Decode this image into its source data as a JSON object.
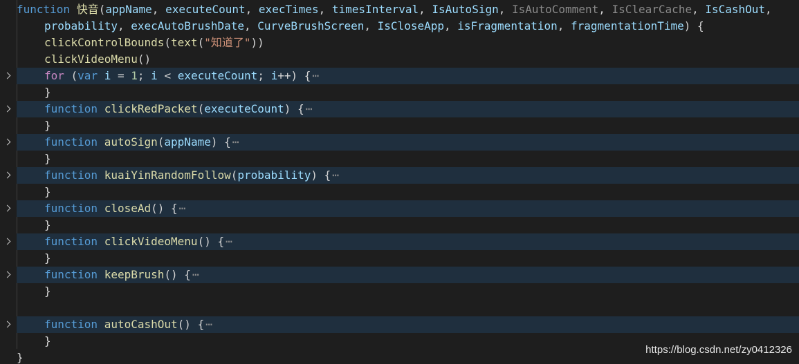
{
  "code_lines": [
    {
      "tokens": [
        [
          "kw",
          "function"
        ],
        [
          "pn",
          " "
        ],
        [
          "fn",
          "快音"
        ],
        [
          "pn",
          "("
        ],
        [
          "pm",
          "appName"
        ],
        [
          "pn",
          ", "
        ],
        [
          "pm",
          "executeCount"
        ],
        [
          "pn",
          ", "
        ],
        [
          "pm",
          "execTimes"
        ],
        [
          "pn",
          ", "
        ],
        [
          "pm",
          "timesInterval"
        ],
        [
          "pn",
          ", "
        ],
        [
          "pm",
          "IsAutoSign"
        ],
        [
          "pn",
          ", "
        ],
        [
          "dim",
          "IsAutoComment"
        ],
        [
          "pn",
          ", "
        ],
        [
          "dim",
          "IsClearCache"
        ],
        [
          "pn",
          ", "
        ],
        [
          "pm",
          "IsCashOut"
        ],
        [
          "pn",
          ","
        ]
      ]
    },
    {
      "tokens": [
        [
          "pm",
          "probability"
        ],
        [
          "pn",
          ", "
        ],
        [
          "pm",
          "execAutoBrushDate"
        ],
        [
          "pn",
          ", "
        ],
        [
          "pm",
          "CurveBrushScreen"
        ],
        [
          "pn",
          ", "
        ],
        [
          "pm",
          "IsCloseApp"
        ],
        [
          "pn",
          ", "
        ],
        [
          "pm",
          "isFragmentation"
        ],
        [
          "pn",
          ", "
        ],
        [
          "pm",
          "fragmentationTime"
        ],
        [
          "pn",
          ") {"
        ]
      ]
    },
    {
      "tokens": [
        [
          "fn",
          "clickControlBounds"
        ],
        [
          "pn",
          "("
        ],
        [
          "fn",
          "text"
        ],
        [
          "pn",
          "("
        ],
        [
          "st",
          "\"知道了\""
        ],
        [
          "pn",
          "))"
        ]
      ]
    },
    {
      "tokens": [
        [
          "fn",
          "clickVideoMenu"
        ],
        [
          "pn",
          "()"
        ]
      ]
    },
    {
      "folded": true,
      "tokens": [
        [
          "ctl",
          "for"
        ],
        [
          "pn",
          " ("
        ],
        [
          "kw",
          "var"
        ],
        [
          "pn",
          " "
        ],
        [
          "pm",
          "i"
        ],
        [
          "pn",
          " = "
        ],
        [
          "nm",
          "1"
        ],
        [
          "pn",
          "; "
        ],
        [
          "pm",
          "i"
        ],
        [
          "pn",
          " < "
        ],
        [
          "pm",
          "executeCount"
        ],
        [
          "pn",
          "; "
        ],
        [
          "pm",
          "i"
        ],
        [
          "pn",
          "++) {"
        ]
      ]
    },
    {
      "tokens": [
        [
          "pn",
          "}"
        ]
      ]
    },
    {
      "folded": true,
      "tokens": [
        [
          "kw",
          "function"
        ],
        [
          "pn",
          " "
        ],
        [
          "fn",
          "clickRedPacket"
        ],
        [
          "pn",
          "("
        ],
        [
          "pm",
          "executeCount"
        ],
        [
          "pn",
          ") {"
        ]
      ]
    },
    {
      "tokens": [
        [
          "pn",
          "}"
        ]
      ]
    },
    {
      "folded": true,
      "tokens": [
        [
          "kw",
          "function"
        ],
        [
          "pn",
          " "
        ],
        [
          "fn",
          "autoSign"
        ],
        [
          "pn",
          "("
        ],
        [
          "pm",
          "appName"
        ],
        [
          "pn",
          ") {"
        ]
      ]
    },
    {
      "tokens": [
        [
          "pn",
          "}"
        ]
      ]
    },
    {
      "folded": true,
      "tokens": [
        [
          "kw",
          "function"
        ],
        [
          "pn",
          " "
        ],
        [
          "fn",
          "kuaiYinRandomFollow"
        ],
        [
          "pn",
          "("
        ],
        [
          "pm",
          "probability"
        ],
        [
          "pn",
          ") {"
        ]
      ]
    },
    {
      "tokens": [
        [
          "pn",
          "}"
        ]
      ]
    },
    {
      "folded": true,
      "tokens": [
        [
          "kw",
          "function"
        ],
        [
          "pn",
          " "
        ],
        [
          "fn",
          "closeAd"
        ],
        [
          "pn",
          "() {"
        ]
      ]
    },
    {
      "tokens": [
        [
          "pn",
          "}"
        ]
      ]
    },
    {
      "folded": true,
      "tokens": [
        [
          "kw",
          "function"
        ],
        [
          "pn",
          " "
        ],
        [
          "fn",
          "clickVideoMenu"
        ],
        [
          "pn",
          "() {"
        ]
      ]
    },
    {
      "tokens": [
        [
          "pn",
          "}"
        ]
      ]
    },
    {
      "folded": true,
      "tokens": [
        [
          "kw",
          "function"
        ],
        [
          "pn",
          " "
        ],
        [
          "fn",
          "keepBrush"
        ],
        [
          "pn",
          "() {"
        ]
      ]
    },
    {
      "tokens": [
        [
          "pn",
          "}"
        ]
      ]
    },
    {
      "tokens": []
    },
    {
      "folded": true,
      "tokens": [
        [
          "kw",
          "function"
        ],
        [
          "pn",
          " "
        ],
        [
          "fn",
          "autoCashOut"
        ],
        [
          "pn",
          "() {"
        ]
      ]
    },
    {
      "tokens": [
        [
          "pn",
          "}"
        ]
      ]
    },
    {
      "tokens": [
        [
          "pn",
          "}"
        ]
      ]
    }
  ],
  "fold_ellipsis": "⋯",
  "watermark": "https://blog.csdn.net/zy0412326"
}
